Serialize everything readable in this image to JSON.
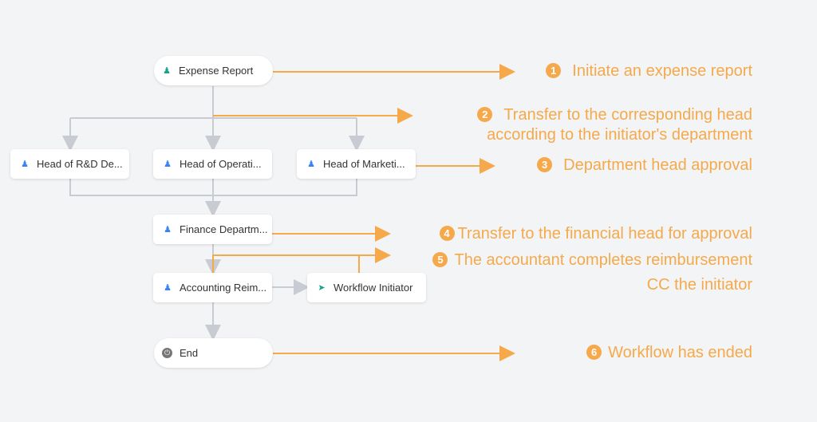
{
  "nodes": {
    "start": "Expense Report",
    "rd": "Head of R&D De...",
    "ops": "Head of Operati...",
    "mkt": "Head of Marketi...",
    "finance": "Finance Departm...",
    "accounting": "Accounting Reim...",
    "initiator": "Workflow Initiator",
    "end": "End"
  },
  "notes": [
    {
      "num": "1",
      "text": "Initiate an expense report"
    },
    {
      "num": "2",
      "text": "Transfer to the corresponding head",
      "text2": "according to the initiator's department"
    },
    {
      "num": "3",
      "text": "Department head approval"
    },
    {
      "num": "4",
      "text": "Transfer to the financial head for approval"
    },
    {
      "num": "5",
      "text": "The accountant completes reimbursement",
      "text2": "CC the initiator"
    },
    {
      "num": "6",
      "text": "Workflow has ended"
    }
  ],
  "colors": {
    "annotation": "#f5a94a",
    "connector": "#c8ccd2",
    "approver_icon": "#3b82f6",
    "start_icon": "#14a38b"
  }
}
